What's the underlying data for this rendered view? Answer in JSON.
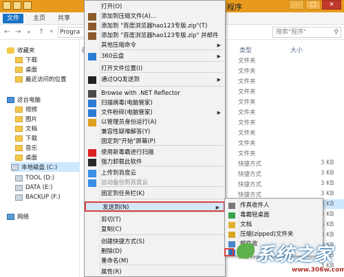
{
  "window": {
    "title_partial": "程序"
  },
  "ribbon": {
    "tabs": [
      "文件",
      "主页",
      "共享"
    ]
  },
  "address": {
    "path_partial": "Progra",
    "search_placeholder": "搜索\"程序\""
  },
  "nav": {
    "favorites_label": "收藏夹",
    "favorites": [
      "下载",
      "桌面",
      "最近访问的位置"
    ],
    "pc_label": "这台电脑",
    "pc_items": [
      "视频",
      "图片",
      "文档",
      "下载",
      "音乐",
      "桌面"
    ],
    "drives": [
      "本地磁盘 (C:)",
      "TOOL (D:)",
      "DATA (E:)",
      "BACKUP (F:)"
    ],
    "network_label": "网络"
  },
  "columns": {
    "name": "名",
    "type": "类型",
    "size": "大小"
  },
  "rows": [
    {
      "time": "",
      "type": "文件夹",
      "size": ""
    },
    {
      "time": "",
      "type": "文件夹",
      "size": ""
    },
    {
      "time": "",
      "type": "文件夹",
      "size": ""
    },
    {
      "time": "",
      "type": "文件夹",
      "size": ""
    },
    {
      "time": "",
      "type": "文件夹",
      "size": ""
    },
    {
      "time": "",
      "type": "文件夹",
      "size": ""
    },
    {
      "time": "",
      "type": "文件夹",
      "size": ""
    },
    {
      "time": "",
      "type": "文件夹",
      "size": ""
    },
    {
      "time": "",
      "type": "文件夹",
      "size": ""
    },
    {
      "time": "",
      "type": "文件夹",
      "size": ""
    },
    {
      "time": "",
      "type": "快捷方式",
      "size": "3 KB"
    },
    {
      "time": "",
      "type": "快捷方式",
      "size": "3 KB"
    },
    {
      "time": "",
      "type": "快捷方式",
      "size": "3 KB"
    },
    {
      "time": "",
      "type": "快捷方式",
      "size": "3 KB"
    },
    {
      "time": ":05",
      "type": "快捷方式",
      "size": "3 KB"
    },
    {
      "time": "",
      "type": "快捷方式",
      "size": "3 KB"
    },
    {
      "time": "",
      "type": "快捷方式",
      "size": "3 KB"
    },
    {
      "time": "",
      "type": "快捷方式",
      "size": "3 KB"
    },
    {
      "time": "",
      "type": "快捷方式",
      "size": "3 KB"
    },
    {
      "time": "",
      "type": "快捷方式",
      "size": "3 KB"
    },
    {
      "time": "",
      "type": "",
      "size": "3 KB"
    }
  ],
  "menu": {
    "items": [
      {
        "label": "打开(O)",
        "arrow": false
      },
      {
        "label": "添加到压缩文件(A)...",
        "arrow": false
      },
      {
        "label": "添加到 \"百度浏览器hao123专版.zip\"(T)",
        "arrow": false
      },
      {
        "label": "添加到 \"百度浏览器hao123专版.zip\" 并邮件",
        "arrow": false
      },
      {
        "label": "其他压缩命令",
        "arrow": true
      },
      {
        "label": "360云盘",
        "arrow": true
      },
      {
        "label": "打开文件位置(I)",
        "arrow": false
      },
      {
        "label": "通过QQ发送到",
        "arrow": true
      },
      {
        "label": "Browse with .NET Reflector",
        "arrow": false
      },
      {
        "label": "扫描病毒(电脑管家)",
        "arrow": false
      },
      {
        "label": "文件粉碎(电脑管家)",
        "arrow": true
      },
      {
        "label": "以管理员身份运行(A)",
        "arrow": false
      },
      {
        "label": "兼容性疑难解答(Y)",
        "arrow": false
      },
      {
        "label": "固定到\"开始\"屏幕(P)",
        "arrow": false
      },
      {
        "label": "使用新毒霸进行扫描",
        "arrow": false
      },
      {
        "label": "强力卸载此软件",
        "arrow": false
      },
      {
        "label": "上传到百度云",
        "arrow": false
      },
      {
        "label": "自动备份到百度云",
        "arrow": false
      },
      {
        "label": "固定到任务栏(K)",
        "arrow": false
      },
      {
        "label": "发送到(N)",
        "arrow": true
      },
      {
        "label": "剪切(T)",
        "arrow": false
      },
      {
        "label": "复制(C)",
        "arrow": false
      },
      {
        "label": "创建快捷方式(S)",
        "arrow": false
      },
      {
        "label": "删除(D)",
        "arrow": false
      },
      {
        "label": "重命名(M)",
        "arrow": false
      },
      {
        "label": "属性(R)",
        "arrow": false
      }
    ]
  },
  "submenu": {
    "items": [
      "传真收件人",
      "毒霸轻桌面",
      "文档",
      "压缩(zipped)文件夹",
      "邮件收",
      "D"
    ]
  },
  "watermark": {
    "brand": "系统之家",
    "url": "www.306w.com"
  },
  "colors": {
    "accent": "#1b74c5",
    "titlebar": "#e89a1c",
    "highlight": "#d64040"
  }
}
